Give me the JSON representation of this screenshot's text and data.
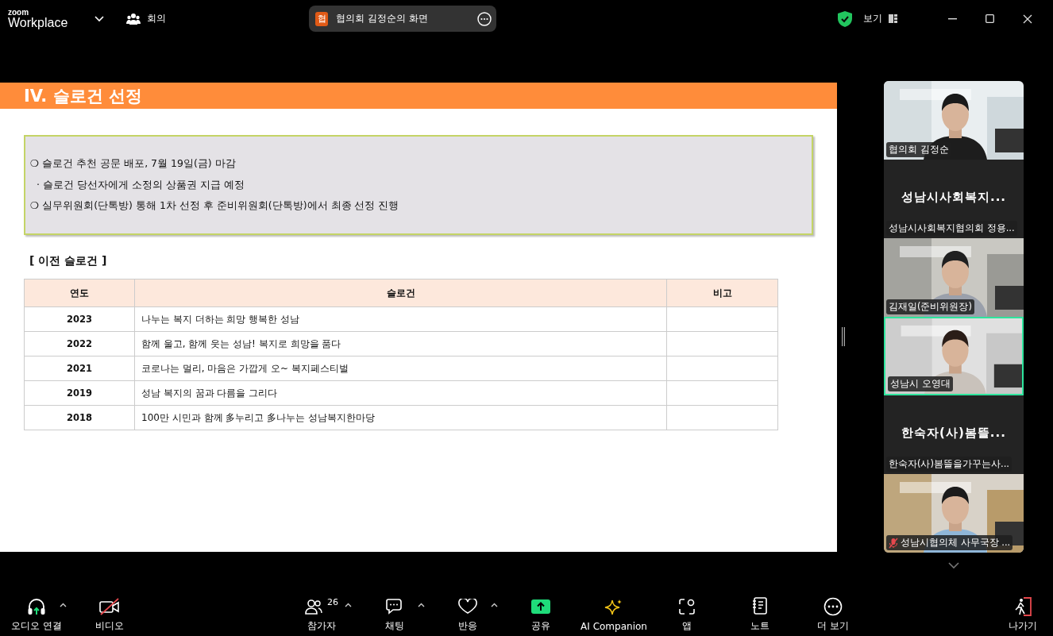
{
  "title_bar": {
    "logo_small": "zoom",
    "logo": "Workplace",
    "meeting_label": "회의",
    "share_badge": "협",
    "share_title": "협의회 김정순의 화면",
    "view_label": "보기"
  },
  "slide": {
    "title": "IV. 슬로건 선정",
    "notes": [
      {
        "kind": "circle",
        "mark": "❍",
        "text": "슬로건 추천 공문 배포, 7월 19일(금) 마감"
      },
      {
        "kind": "sub",
        "mark": "·",
        "text": "슬로건 당선자에게 소정의 상품권 지급 예정"
      },
      {
        "kind": "circle",
        "mark": "❍",
        "text": "실무위원회(단톡방) 통해 1차 선정 후 준비위원회(단톡방)에서 최종 선정 진행"
      }
    ],
    "section_title": "[ 이전 슬로건 ]",
    "table": {
      "columns": [
        "연도",
        "슬로건",
        "비고"
      ],
      "rows": [
        [
          "2023",
          "나누는 복지 더하는 희망 행복한 성남"
        ],
        [
          "2022",
          "함께 울고, 함께 웃는 성남! 복지로 희망을 품다"
        ],
        [
          "2021",
          "코로나는 멀리, 마음은 가깝게 오~ 복지페스티벌"
        ],
        [
          "2019",
          "성남 복지의 꿈과 다름을 그리다"
        ],
        [
          "2018",
          "100만 시민과 함께 多누리고 多나누는 성남복지한마당"
        ]
      ]
    }
  },
  "participants": [
    {
      "kind": "video",
      "label": "협의회 김정순",
      "speaking": false,
      "muted": false
    },
    {
      "kind": "name",
      "display": "성남시사회복지...",
      "label": "성남시사회복지협의회 정용...",
      "speaking": false,
      "muted": false
    },
    {
      "kind": "video",
      "label": "김재일(준비위원장)",
      "speaking": false,
      "muted": false
    },
    {
      "kind": "video",
      "label": "성남시 오영대",
      "speaking": true,
      "muted": false
    },
    {
      "kind": "name",
      "display": "한숙자(사)봄뜰...",
      "label": "한숙자(사)봄뜰을가꾸는사...",
      "speaking": false,
      "muted": false
    },
    {
      "kind": "video",
      "label": "성남시협의체 사무국장 ...",
      "speaking": false,
      "muted": true
    }
  ],
  "toolbar": [
    {
      "kind": "audio",
      "label": "오디오 연결",
      "caret": true
    },
    {
      "kind": "video",
      "label": "비디오",
      "caret": false
    },
    {
      "kind": "participants",
      "label": "참가자",
      "count": "26",
      "caret": true
    },
    {
      "kind": "chat",
      "label": "채팅",
      "caret": true
    },
    {
      "kind": "reactions",
      "label": "반응",
      "caret": true
    },
    {
      "kind": "share",
      "label": "공유",
      "caret": false
    },
    {
      "kind": "ai",
      "label": "AI Companion",
      "caret": false
    },
    {
      "kind": "apps",
      "label": "앱",
      "caret": false
    },
    {
      "kind": "notes",
      "label": "노트",
      "caret": false
    },
    {
      "kind": "more",
      "label": "더 보기",
      "caret": false
    },
    {
      "kind": "leave",
      "label": "나가기",
      "caret": false
    }
  ]
}
